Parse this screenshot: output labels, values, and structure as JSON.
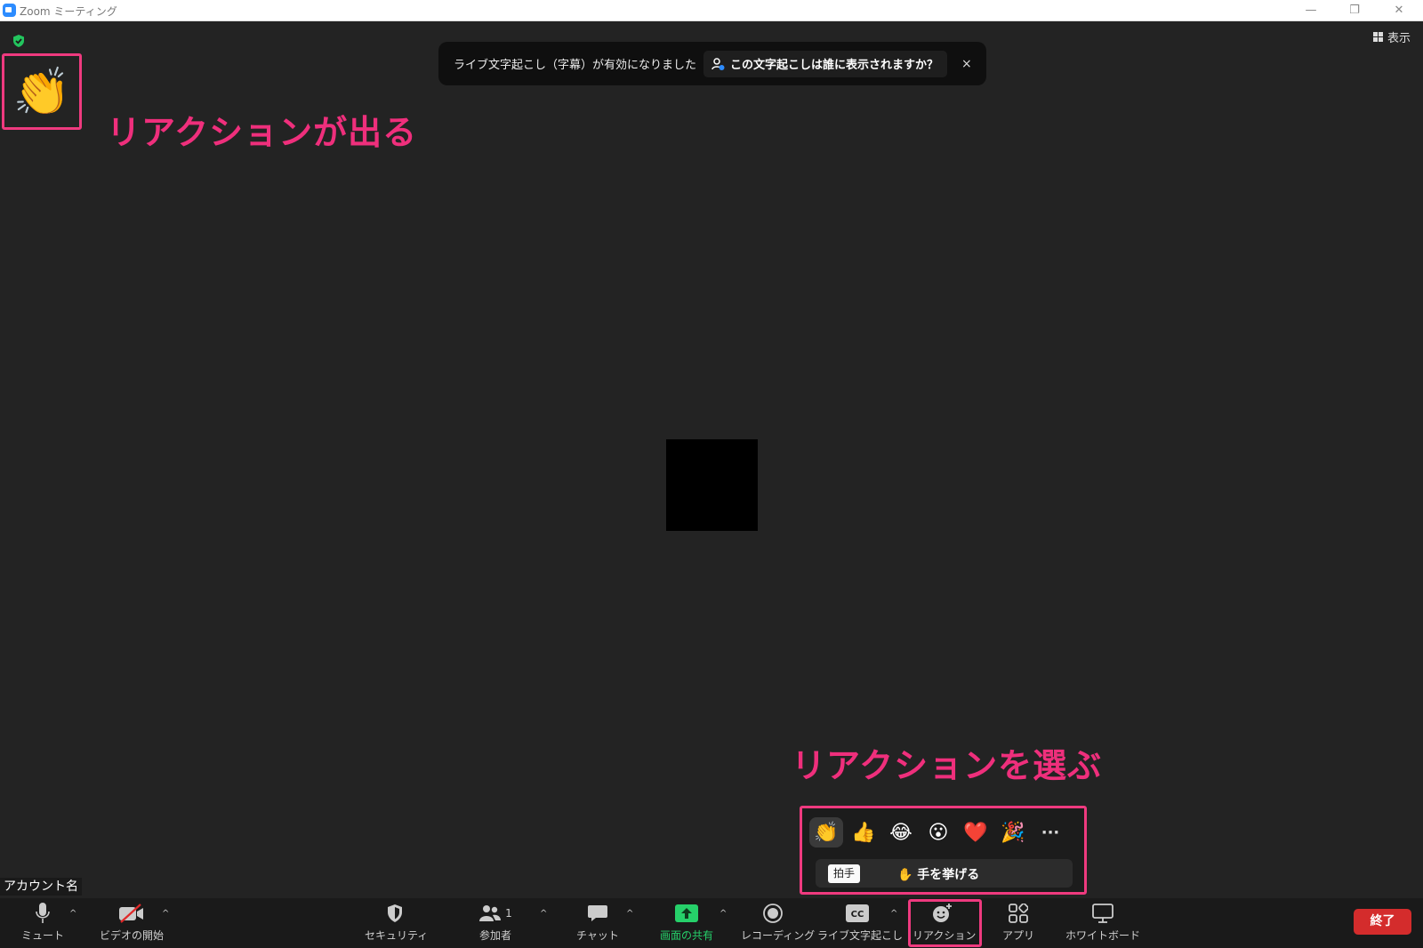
{
  "window": {
    "title": "Zoom ミーティング",
    "controls": {
      "minimize": "—",
      "restore": "❐",
      "close": "✕"
    }
  },
  "header": {
    "view_label": "表示"
  },
  "notice": {
    "message": "ライブ文字起こし（字幕）が有効になりました",
    "question": "この文字起こしは誰に表示されますか？",
    "close": "×"
  },
  "reaction_shown": {
    "emoji": "👏"
  },
  "annotations": {
    "top": "リアクションが出る",
    "bottom": "リアクションを選ぶ"
  },
  "account_name": "アカウント名",
  "reaction_popup": {
    "emojis": [
      "👏",
      "👍",
      "😂",
      "😮",
      "❤️",
      "🎉"
    ],
    "more": "···",
    "tooltip": "拍手",
    "raise_hand": "✋ 手を挙げる"
  },
  "toolbar": {
    "mute": "ミュート",
    "video": "ビデオの開始",
    "security": "セキュリティ",
    "participants": "参加者",
    "participants_count": "1",
    "chat": "チャット",
    "share": "画面の共有",
    "record": "レコーディング",
    "captions": "ライブ文字起こし",
    "reactions": "リアクション",
    "apps": "アプリ",
    "whiteboard": "ホワイトボード",
    "end": "終了",
    "caret": "^"
  },
  "colors": {
    "accent_annotation": "#ef2f7c",
    "share_green": "#26d06a",
    "end_red": "#d42c2c",
    "shield_green": "#23c55e"
  }
}
